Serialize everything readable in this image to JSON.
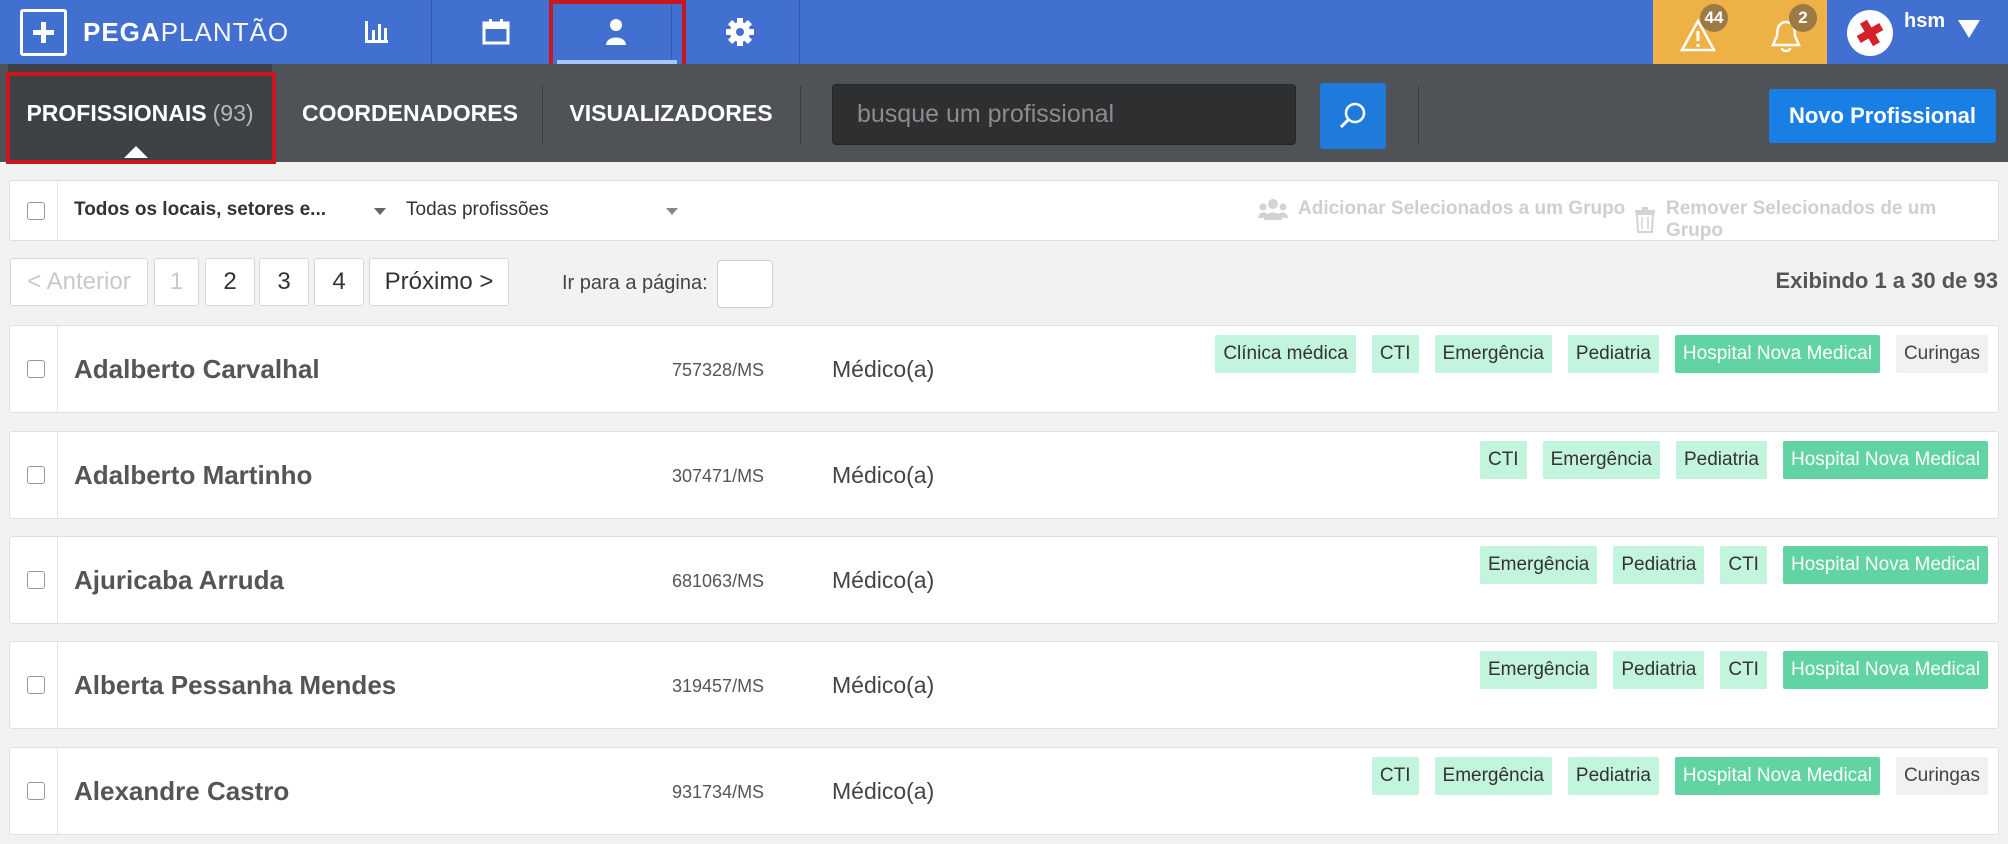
{
  "app": {
    "brand_bold": "PEGA",
    "brand_light": "PLANTÃO"
  },
  "nav": {
    "items": [
      {
        "icon": "bar-chart-icon"
      },
      {
        "icon": "calendar-icon"
      },
      {
        "icon": "person-icon",
        "active": true
      },
      {
        "icon": "gear-icon"
      }
    ],
    "alerts_count": "44",
    "notifications_count": "2",
    "user_name": "hsm"
  },
  "subnav": {
    "tab_profissionais": "PROFISSIONAIS",
    "tab_profissionais_count": "(93)",
    "tab_coordenadores": "COORDENADORES",
    "tab_visualizadores": "VISUALIZADORES",
    "search_placeholder": "busque um profissional",
    "new_button": "Novo Profissional"
  },
  "filters": {
    "locations": "Todos os locais, setores e...",
    "professions": "Todas profissões",
    "add_to_group": "Adicionar Selecionados a um Grupo",
    "remove_from_group": "Remover Selecionados de um Grupo"
  },
  "pagination": {
    "prev": "< Anterior",
    "pages": [
      "1",
      "2",
      "3",
      "4"
    ],
    "next": "Próximo >",
    "goto_label": "Ir para a página:",
    "showing": "Exibindo 1 a 30 de 93"
  },
  "colors": {
    "topbar": "#4270d1",
    "subbar": "#4f5357",
    "accent_blue": "#1a7fe4",
    "alerts_bg": "#eeb145",
    "tag_light": "#c3f4dd",
    "tag_hospital": "#62d3a3",
    "highlight_red": "#c8171e"
  },
  "rows": [
    {
      "name": "Adalberto Carvalhal",
      "reg": "757328/MS",
      "prof": "Médico(a)",
      "tags": [
        "Clínica médica",
        "CTI",
        "Emergência",
        "Pediatria",
        "Hospital Nova Medical",
        "Curingas"
      ]
    },
    {
      "name": "Adalberto Martinho",
      "reg": "307471/MS",
      "prof": "Médico(a)",
      "tags": [
        "CTI",
        "Emergência",
        "Pediatria",
        "Hospital Nova Medical"
      ]
    },
    {
      "name": "Ajuricaba Arruda",
      "reg": "681063/MS",
      "prof": "Médico(a)",
      "tags": [
        "Emergência",
        "Pediatria",
        "CTI",
        "Hospital Nova Medical"
      ]
    },
    {
      "name": "Alberta Pessanha Mendes",
      "reg": "319457/MS",
      "prof": "Médico(a)",
      "tags": [
        "Emergência",
        "Pediatria",
        "CTI",
        "Hospital Nova Medical"
      ]
    },
    {
      "name": "Alexandre Castro",
      "reg": "931734/MS",
      "prof": "Médico(a)",
      "tags": [
        "CTI",
        "Emergência",
        "Pediatria",
        "Hospital Nova Medical",
        "Curingas"
      ]
    }
  ]
}
